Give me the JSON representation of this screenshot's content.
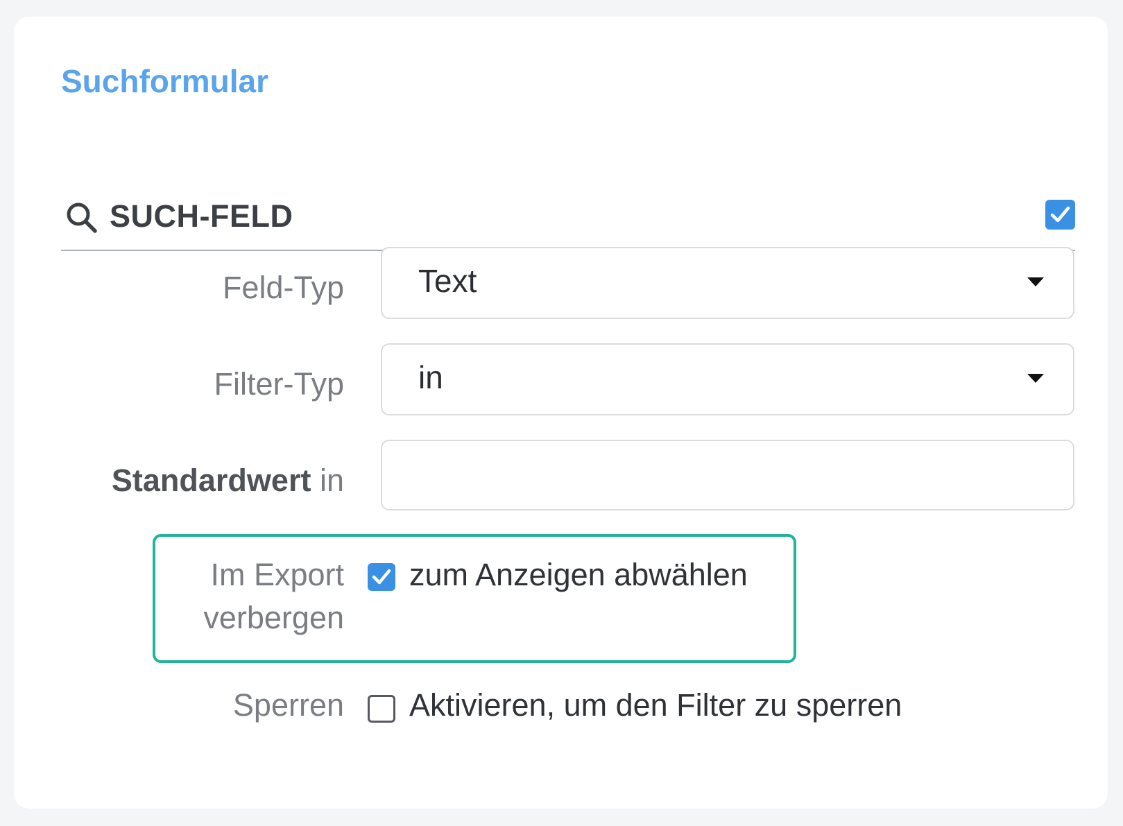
{
  "form": {
    "title": "Suchformular"
  },
  "section": {
    "icon": "search-icon",
    "title": "SUCH-FELD",
    "enabled": true
  },
  "fields": {
    "field_type": {
      "label": "Feld-Typ",
      "value": "Text"
    },
    "filter_type": {
      "label": "Filter-Typ",
      "value": "in"
    },
    "default_value": {
      "label_bold": "Standardwert",
      "label_suffix": "in",
      "value": ""
    },
    "hide_in_export": {
      "label_line1": "Im Export",
      "label_line2": "verbergen",
      "checked": true,
      "check_label": "zum Anzeigen abwählen"
    },
    "lock": {
      "label": "Sperren",
      "checked": false,
      "check_label": "Aktivieren, um den Filter zu sperren"
    }
  },
  "colors": {
    "accent": "#3a91e4",
    "title": "#5aa4ec",
    "highlight": "#23b39a"
  }
}
